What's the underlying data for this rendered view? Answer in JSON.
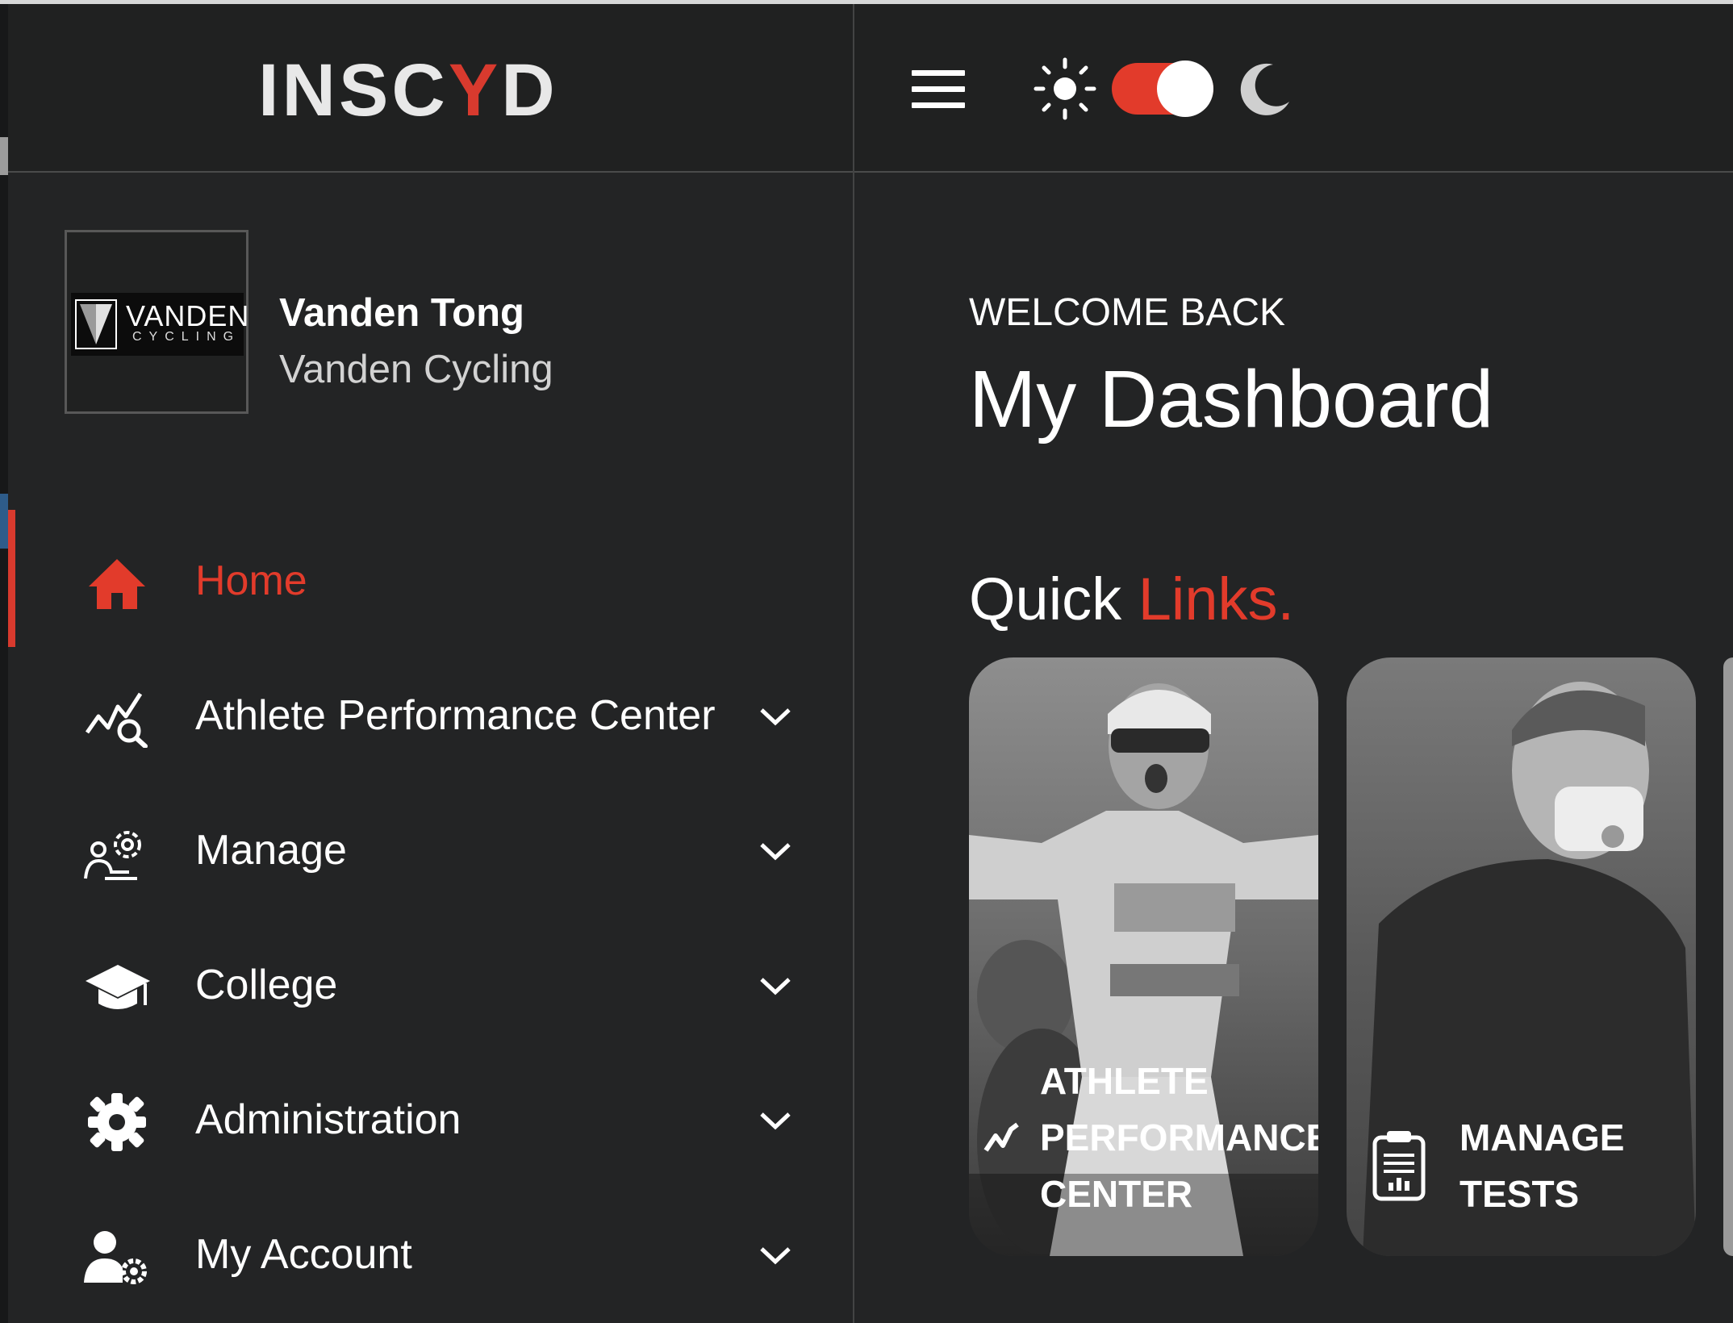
{
  "header": {
    "logo": {
      "prefix": "INSC",
      "accent": "Y",
      "suffix": "D"
    },
    "menu_icon": "hamburger-icon",
    "theme_toggle": {
      "left_icon": "sun-icon",
      "right_icon": "moon-icon",
      "state": "dark"
    }
  },
  "profile": {
    "logo_text_main": "VANDEN",
    "logo_text_sub": "CYCLING",
    "name": "Vanden Tong",
    "organization": "Vanden Cycling"
  },
  "sidebar": {
    "items": [
      {
        "label": "Home",
        "icon": "home-icon",
        "active": true
      },
      {
        "label": "Athlete Performance Center",
        "icon": "chart-search-icon",
        "expandable": true
      },
      {
        "label": "Manage",
        "icon": "people-gear-icon",
        "expandable": true
      },
      {
        "label": "College",
        "icon": "graduation-cap-icon",
        "expandable": true
      },
      {
        "label": "Administration",
        "icon": "gear-icon",
        "expandable": true
      },
      {
        "label": "My Account",
        "icon": "user-gear-icon",
        "expandable": true
      }
    ]
  },
  "main": {
    "welcome": "WELCOME BACK",
    "title": "My Dashboard",
    "quick_links_title": {
      "plain": "Quick ",
      "accent": "Links."
    },
    "cards": [
      {
        "line1": "ATHLETE",
        "line2": "PERFORMANCE",
        "line3": "CENTER",
        "icon": "performance-icon"
      },
      {
        "line1": "MANAGE",
        "line2": "TESTS",
        "icon": "clipboard-chart-icon"
      }
    ]
  },
  "colors": {
    "accent": "#e23b2b",
    "background": "#232425",
    "header": "#202121"
  }
}
